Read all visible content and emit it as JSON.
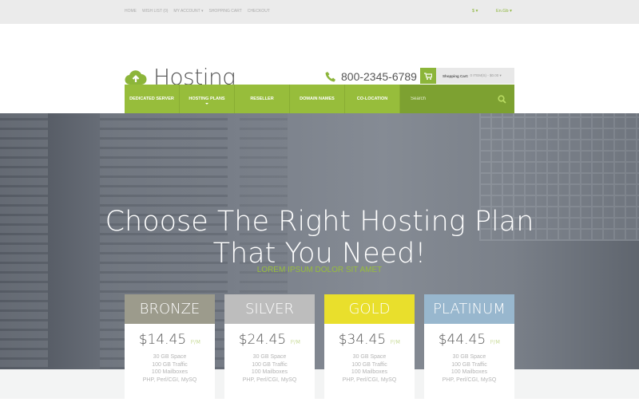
{
  "topbar": {
    "links": [
      "HOME",
      "WISH LIST (0)",
      "MY ACCOUNT ▾",
      "SHOPPING CART",
      "CHECKOUT"
    ],
    "currency": "$ ▾",
    "language": "En.Gb ▾"
  },
  "header": {
    "logo": "Hosting",
    "phone": "800-2345-6789",
    "cart_label": "Shopping Cart:",
    "cart_value": "0 ITEM(S) - $0.00 ▾"
  },
  "nav": {
    "items": [
      "DEDICATED SERVER",
      "HOSTING PLANS",
      "RESELLER",
      "DOMAIN NAMES",
      "CO-LOCATION"
    ],
    "search_placeholder": "Search"
  },
  "hero": {
    "title_line1": "Choose The Right Hosting Plan",
    "title_line2": "That You Need!",
    "subtitle": "LOREM IPSUM DOLOR SIT AMET"
  },
  "colors": {
    "accent": "#97bd3b",
    "bronze": "#9c9b8c",
    "silver": "#bdbdbd",
    "gold": "#e9df2c",
    "platinum": "#98b7ce"
  },
  "plans": [
    {
      "name": "BRONZE",
      "price": "$14.45",
      "period": "P/M",
      "features": [
        "30 GB Space",
        "100 GB Traffic",
        "100 Mailboxes",
        "PHP, Perl/CGI, MySQ"
      ]
    },
    {
      "name": "SILVER",
      "price": "$24.45",
      "period": "P/M",
      "features": [
        "30 GB Space",
        "100 GB Traffic",
        "100 Mailboxes",
        "PHP, Perl/CGI, MySQ"
      ]
    },
    {
      "name": "GOLD",
      "price": "$34.45",
      "period": "P/M",
      "features": [
        "30 GB Space",
        "100 GB Traffic",
        "100 Mailboxes",
        "PHP, Perl/CGI, MySQ"
      ]
    },
    {
      "name": "PLATINUM",
      "price": "$44.45",
      "period": "P/M",
      "features": [
        "30 GB Space",
        "100 GB Traffic",
        "100 Mailboxes",
        "PHP, Perl/CGI, MySQ"
      ]
    }
  ]
}
